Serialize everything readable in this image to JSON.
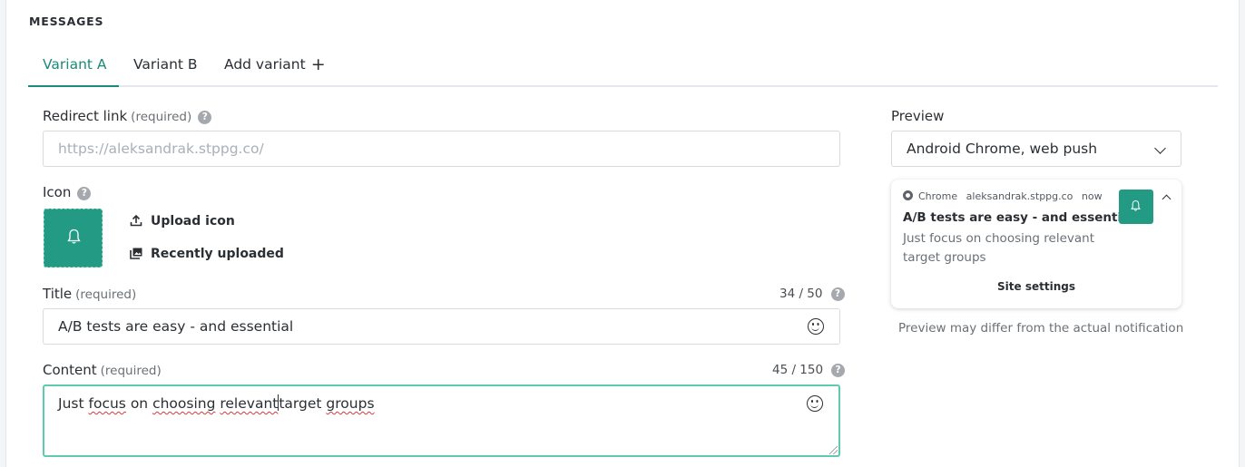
{
  "section": {
    "title": "MESSAGES"
  },
  "tabs": [
    {
      "label": "Variant A",
      "active": true
    },
    {
      "label": "Variant B",
      "active": false
    },
    {
      "label": "Add variant",
      "active": false
    }
  ],
  "form": {
    "redirect": {
      "label": "Redirect link",
      "required": "(required)",
      "placeholder": "https://aleksandrak.stppg.co/"
    },
    "icon": {
      "label": "Icon",
      "upload_label": "Upload icon",
      "recent_label": "Recently uploaded"
    },
    "title": {
      "label": "Title",
      "required": "(required)",
      "value": "A/B tests are easy - and essential",
      "counter": "34 / 50"
    },
    "content": {
      "label": "Content",
      "required": "(required)",
      "counter": "45 / 150",
      "words": [
        "Just",
        "focus",
        "on",
        "choosing",
        "relevant",
        "target",
        "groups"
      ]
    }
  },
  "preview": {
    "label": "Preview",
    "device": "Android Chrome, web push",
    "notification": {
      "browser": "Chrome",
      "domain": "aleksandrak.stppg.co",
      "time": "now",
      "title": "A/B tests are easy - and essential",
      "body": "Just focus on choosing relevant target groups",
      "action": "Site settings"
    },
    "note": "Preview may differ from the actual notification"
  },
  "colors": {
    "accent": "#1c8a78",
    "icon_bg": "#239b84",
    "focus_border": "#5fc9b2"
  }
}
